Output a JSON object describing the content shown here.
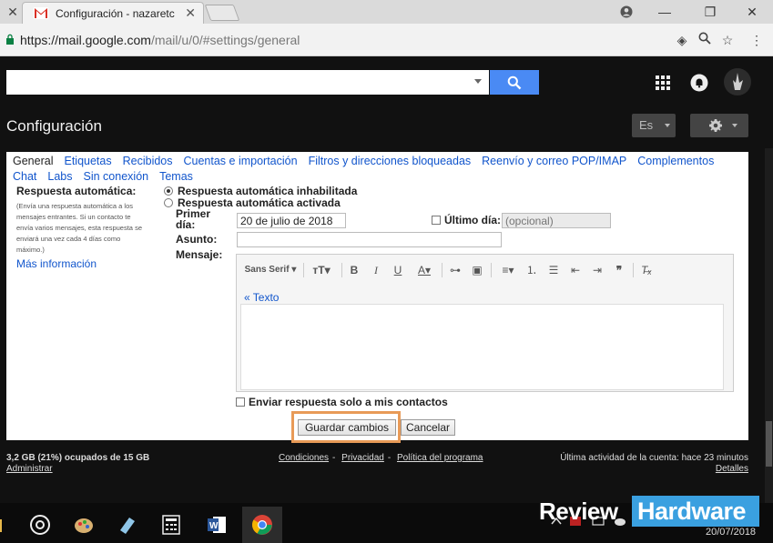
{
  "browser": {
    "tab_title": "Configuración - nazaretc",
    "url_host": "https://mail.google.com",
    "url_path": "/mail/u/0/#settings/general"
  },
  "gmail": {
    "search_placeholder": "",
    "page_title": "Configuración",
    "lang_label": "Es"
  },
  "tabs_row1": [
    "General",
    "Etiquetas",
    "Recibidos",
    "Cuentas e importación",
    "Filtros y direcciones bloqueadas",
    "Reenvío y correo POP/IMAP",
    "Complementos"
  ],
  "tabs_row2": [
    "Chat",
    "Labs",
    "Sin conexión",
    "Temas"
  ],
  "active_tab": "General",
  "autoreply": {
    "title": "Respuesta automática:",
    "description": "(Envía una respuesta automática a los mensajes entrantes. Si un contacto te envía varios mensajes, esta respuesta se enviará una vez cada 4 días como máximo.)",
    "more_info": "Más información",
    "option_off": "Respuesta automática inhabilitada",
    "option_on": "Respuesta automática activada",
    "selected": "off",
    "first_day_label": "Primer día:",
    "first_day_value": "20 de julio de 2018",
    "last_day_label": "Último día:",
    "last_day_placeholder": "(opcional)",
    "subject_label": "Asunto:",
    "subject_value": "",
    "message_label": "Mensaje:",
    "font_name": "Sans Serif",
    "texto_link": "« Texto",
    "contacts_only_label": "Enviar respuesta solo a mis contactos"
  },
  "buttons": {
    "save": "Guardar cambios",
    "cancel": "Cancelar"
  },
  "footer": {
    "storage": "3,2 GB (21%) ocupados de 15 GB",
    "manage": "Administrar",
    "terms": "Condiciones",
    "privacy": "Privacidad",
    "policy": "Política del programa",
    "last_activity": "Última actividad de la cuenta: hace 23 minutos",
    "details": "Detalles"
  },
  "taskbar": {
    "date": "20/07/2018",
    "watermark_review": "Review",
    "watermark_hardware": "Hardware"
  },
  "colors": {
    "search_blue": "#4a8af4",
    "link_blue": "#1155cc",
    "highlight_orange": "#e89a57",
    "watermark_blue": "#3aa0e0"
  }
}
